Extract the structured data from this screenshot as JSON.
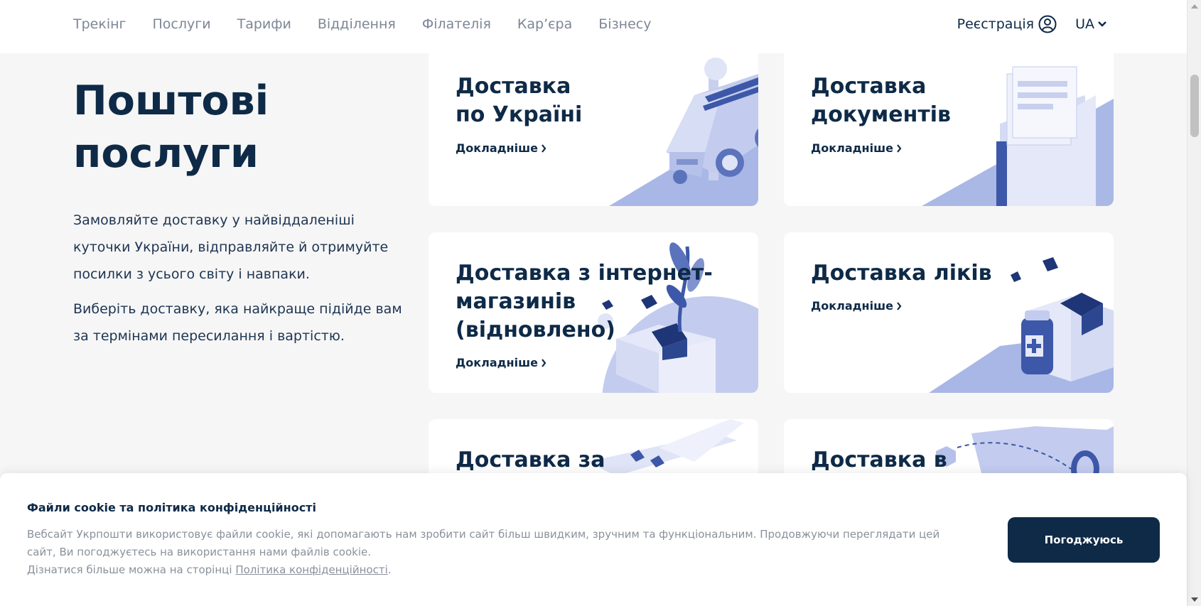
{
  "nav": {
    "items": [
      "Трекінг",
      "Послуги",
      "Тарифи",
      "Відділення",
      "Філателія",
      "Кар’єра",
      "Бізнесу"
    ],
    "register_label": "Реєстрація",
    "lang_label": "UA"
  },
  "hero": {
    "title_line1": "Поштові",
    "title_line2": "послуги",
    "paragraph1": "Замовляйте доставку у найвіддаленіші куточки України, відправляйте й отримуйте посилки з усього світу і навпаки.",
    "paragraph2": "Виберіть доставку, яка найкраще підійде вам за термінами пересилання і вартістю."
  },
  "cards": [
    {
      "line1": "Доставка",
      "line2": "по Україні",
      "line3": "",
      "link": "Докладніше"
    },
    {
      "line1": "Доставка",
      "line2": "документів",
      "line3": "",
      "link": "Докладніше"
    },
    {
      "line1": "Доставка з інтернет-",
      "line2": "магазинів",
      "line3": "(відновлено)",
      "link": "Докладніше"
    },
    {
      "line1": "Доставка ліків",
      "line2": "",
      "line3": "",
      "link": "Докладніше"
    },
    {
      "line1": "Доставка за",
      "line2": "",
      "line3": "",
      "link": ""
    },
    {
      "line1": "Доставка в",
      "line2": "",
      "line3": "",
      "link": ""
    }
  ],
  "cookie": {
    "title": "Файли cookie та політика конфіденційності",
    "text1": "Вебсайт Укрпошти використовує файли cookie, які допомагають нам зробити сайт більш швидким, зручним та функціональним. Продовжуючи переглядати цей сайт, Ви погоджуєтесь на використання нами файлів cookie.",
    "text2_prefix": "Дізнатися більше можна на сторінці ",
    "policy_link": "Політика конфіденційності",
    "text2_suffix": ".",
    "accept_label": "Погоджуюсь"
  }
}
